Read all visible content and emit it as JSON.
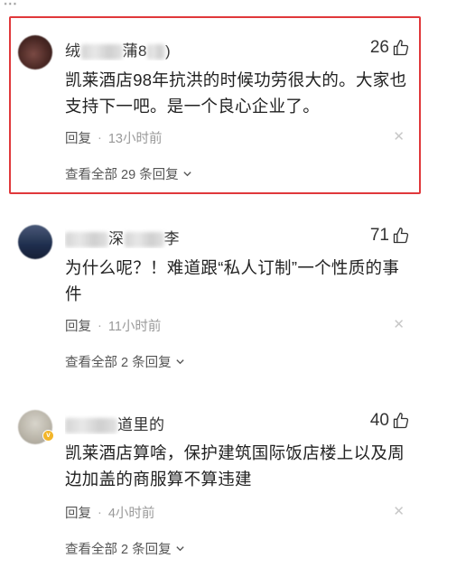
{
  "top_fragment": "...",
  "comments": [
    {
      "username_visible_start": "绒",
      "username_visible_mid": "蒲8",
      "username_visible_end": ")",
      "likes": "26",
      "text": "凯莱酒店98年抗洪的时候功劳很大的。大家也支持下一吧。是一个良心企业了。",
      "reply_label": "回复",
      "time": "13小时前",
      "view_all": "查看全部 29 条回复",
      "highlighted": true
    },
    {
      "username_visible_mid": "深",
      "username_visible_end": "李",
      "likes": "71",
      "text": "为什么呢？！难道跟“私人订制”一个性质的事件",
      "reply_label": "回复",
      "time": "11小时前",
      "view_all": "查看全部 2 条回复"
    },
    {
      "username_visible_end": "道里的",
      "likes": "40",
      "text": "凯莱酒店算啥，保护建筑国际饭店楼上以及周边加盖的商服算不算违建",
      "reply_label": "回复",
      "time": "4小时前",
      "view_all": "查看全部 2 条回复"
    }
  ],
  "icons": {
    "like": "thumbs-up-icon",
    "close": "close-icon",
    "chevron": "chevron-down-icon"
  },
  "colors": {
    "highlight_border": "#e0383b",
    "meta_gray": "#999999"
  }
}
